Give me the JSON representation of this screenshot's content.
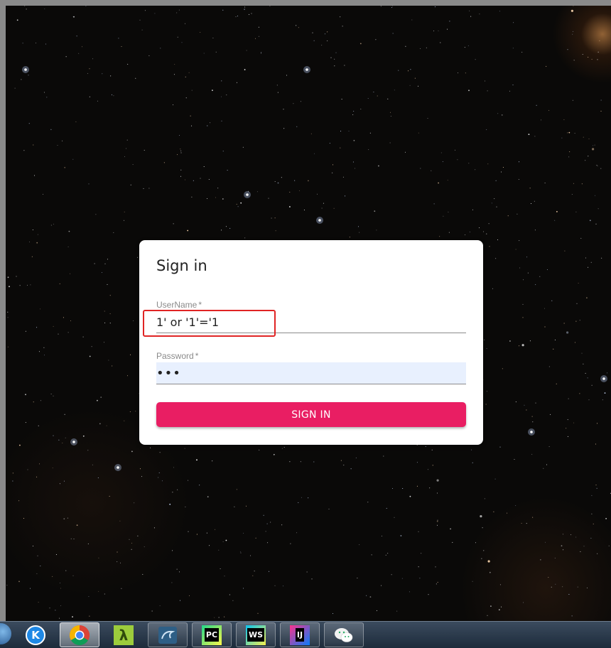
{
  "login": {
    "title": "Sign in",
    "username_label": "UserName",
    "username_value": "1' or '1'='1",
    "password_label": "Password",
    "password_value": "•••",
    "required_marker": "*",
    "submit_label": "SIGN IN"
  },
  "annotation": {
    "highlight_color": "#e02424"
  },
  "colors": {
    "accent": "#e91e63",
    "autofill_bg": "#e8f0fe",
    "background": "#0a0908"
  },
  "taskbar": {
    "apps": [
      {
        "icon": "kugou-music-icon",
        "glyph": "K"
      },
      {
        "icon": "chrome-icon",
        "glyph": ""
      },
      {
        "icon": "lambda-app-icon",
        "glyph": "λ"
      },
      {
        "icon": "mysql-workbench-icon",
        "glyph": ""
      },
      {
        "icon": "pycharm-icon",
        "glyph": "PC"
      },
      {
        "icon": "webstorm-icon",
        "glyph": "WS"
      },
      {
        "icon": "intellij-idea-icon",
        "glyph": "IJ"
      },
      {
        "icon": "wechat-icon",
        "glyph": ""
      }
    ]
  }
}
